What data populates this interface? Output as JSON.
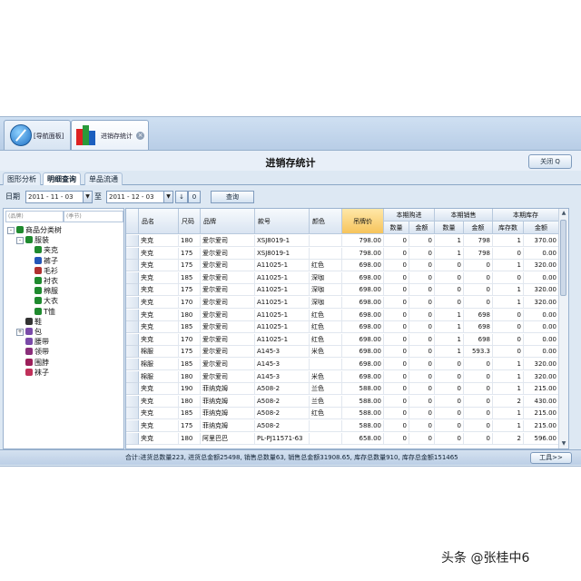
{
  "tabs": [
    {
      "label": "[导航面板]",
      "active": false
    },
    {
      "label": "进销存统计",
      "active": true,
      "close": "×"
    }
  ],
  "title": "进销存统计",
  "close_button": "关闭 Q",
  "subtabs": [
    "图形分析",
    "明细查询",
    "单品流通"
  ],
  "active_subtab": 1,
  "filter": {
    "date_label": "日期",
    "from": "2011 - 11 - 03",
    "to_label": "至",
    "to": "2011 - 12 - 03",
    "down_button": "↓",
    "zero_button": "0",
    "query_button": "查询"
  },
  "tree": {
    "search_brand": "(品牌)",
    "search_season": "(季节)",
    "nodes": [
      {
        "label": "商品分类树",
        "level": 0,
        "expander": "-",
        "icon": "shirt-icon"
      },
      {
        "label": "服装",
        "level": 1,
        "expander": "-",
        "icon": "shirt-icon"
      },
      {
        "label": "夹克",
        "level": 2,
        "icon": "jacket-icon"
      },
      {
        "label": "裤子",
        "level": 2,
        "icon": "pants-icon"
      },
      {
        "label": "毛衫",
        "level": 2,
        "icon": "sweater-icon"
      },
      {
        "label": "衬衣",
        "level": 2,
        "icon": "shirt-icon"
      },
      {
        "label": "棉服",
        "level": 2,
        "icon": "coat-icon"
      },
      {
        "label": "大衣",
        "level": 2,
        "icon": "coat-icon"
      },
      {
        "label": "T恤",
        "level": 2,
        "icon": "tshirt-icon"
      },
      {
        "label": "鞋",
        "level": 1,
        "icon": "shoe-icon"
      },
      {
        "label": "包",
        "level": 1,
        "expander": "+",
        "icon": "bag-icon"
      },
      {
        "label": "腰带",
        "level": 1,
        "icon": "belt-icon"
      },
      {
        "label": "领带",
        "level": 1,
        "icon": "tie-icon"
      },
      {
        "label": "围脖",
        "level": 1,
        "icon": "scarf-icon"
      },
      {
        "label": "袜子",
        "level": 1,
        "icon": "sock-icon"
      }
    ]
  },
  "grid": {
    "headers": [
      "品名",
      "尺码",
      "品牌",
      "款号",
      "颜色",
      "吊牌价"
    ],
    "groups": [
      "本期购进",
      "本期销售",
      "本期库存"
    ],
    "subheaders": [
      "数量",
      "金额",
      "数量",
      "金额",
      "库存数",
      "金额"
    ],
    "rows": [
      [
        "夹克",
        "180",
        "爱尔爱司",
        "XSJ8019-1",
        "",
        "798.00",
        "0",
        "0",
        "1",
        "798",
        "1",
        "370.00"
      ],
      [
        "夹克",
        "175",
        "爱尔爱司",
        "XSJ8019-1",
        "",
        "798.00",
        "0",
        "0",
        "1",
        "798",
        "0",
        "0.00"
      ],
      [
        "夹克",
        "175",
        "爱尔爱司",
        "A11025-1",
        "红色",
        "698.00",
        "0",
        "0",
        "0",
        "0",
        "1",
        "320.00"
      ],
      [
        "夹克",
        "185",
        "爱尔爱司",
        "A11025-1",
        "深咖",
        "698.00",
        "0",
        "0",
        "0",
        "0",
        "0",
        "0.00"
      ],
      [
        "夹克",
        "175",
        "爱尔爱司",
        "A11025-1",
        "深咖",
        "698.00",
        "0",
        "0",
        "0",
        "0",
        "1",
        "320.00"
      ],
      [
        "夹克",
        "170",
        "爱尔爱司",
        "A11025-1",
        "深咖",
        "698.00",
        "0",
        "0",
        "0",
        "0",
        "1",
        "320.00"
      ],
      [
        "夹克",
        "180",
        "爱尔爱司",
        "A11025-1",
        "红色",
        "698.00",
        "0",
        "0",
        "1",
        "698",
        "0",
        "0.00"
      ],
      [
        "夹克",
        "185",
        "爱尔爱司",
        "A11025-1",
        "红色",
        "698.00",
        "0",
        "0",
        "1",
        "698",
        "0",
        "0.00"
      ],
      [
        "夹克",
        "170",
        "爱尔爱司",
        "A11025-1",
        "红色",
        "698.00",
        "0",
        "0",
        "1",
        "698",
        "0",
        "0.00"
      ],
      [
        "棉服",
        "175",
        "爱尔爱司",
        "A145-3",
        "米色",
        "698.00",
        "0",
        "0",
        "1",
        "593.3",
        "0",
        "0.00"
      ],
      [
        "棉服",
        "185",
        "爱尔爱司",
        "A145-3",
        "",
        "698.00",
        "0",
        "0",
        "0",
        "0",
        "1",
        "320.00"
      ],
      [
        "棉服",
        "180",
        "爱尔爱司",
        "A145-3",
        "米色",
        "698.00",
        "0",
        "0",
        "0",
        "0",
        "1",
        "320.00"
      ],
      [
        "夹克",
        "190",
        "菲纳克姆",
        "A508-2",
        "兰色",
        "588.00",
        "0",
        "0",
        "0",
        "0",
        "1",
        "215.00"
      ],
      [
        "夹克",
        "180",
        "菲纳克姆",
        "A508-2",
        "兰色",
        "588.00",
        "0",
        "0",
        "0",
        "0",
        "2",
        "430.00"
      ],
      [
        "夹克",
        "185",
        "菲纳克姆",
        "A508-2",
        "红色",
        "588.00",
        "0",
        "0",
        "0",
        "0",
        "1",
        "215.00"
      ],
      [
        "夹克",
        "175",
        "菲纳克姆",
        "A508-2",
        "",
        "588.00",
        "0",
        "0",
        "0",
        "0",
        "1",
        "215.00"
      ],
      [
        "夹克",
        "180",
        "阿里巴巴",
        "PL-PJ11571-63",
        "",
        "658.00",
        "0",
        "0",
        "0",
        "0",
        "2",
        "596.00"
      ]
    ]
  },
  "summary": "合计:进货总数量223, 进货总金额25498, 销售总数量63, 销售总金额31908.65, 库存总数量910, 库存总金额151465",
  "tools_button": "工具>>",
  "watermark": "头条 @张桂中6"
}
